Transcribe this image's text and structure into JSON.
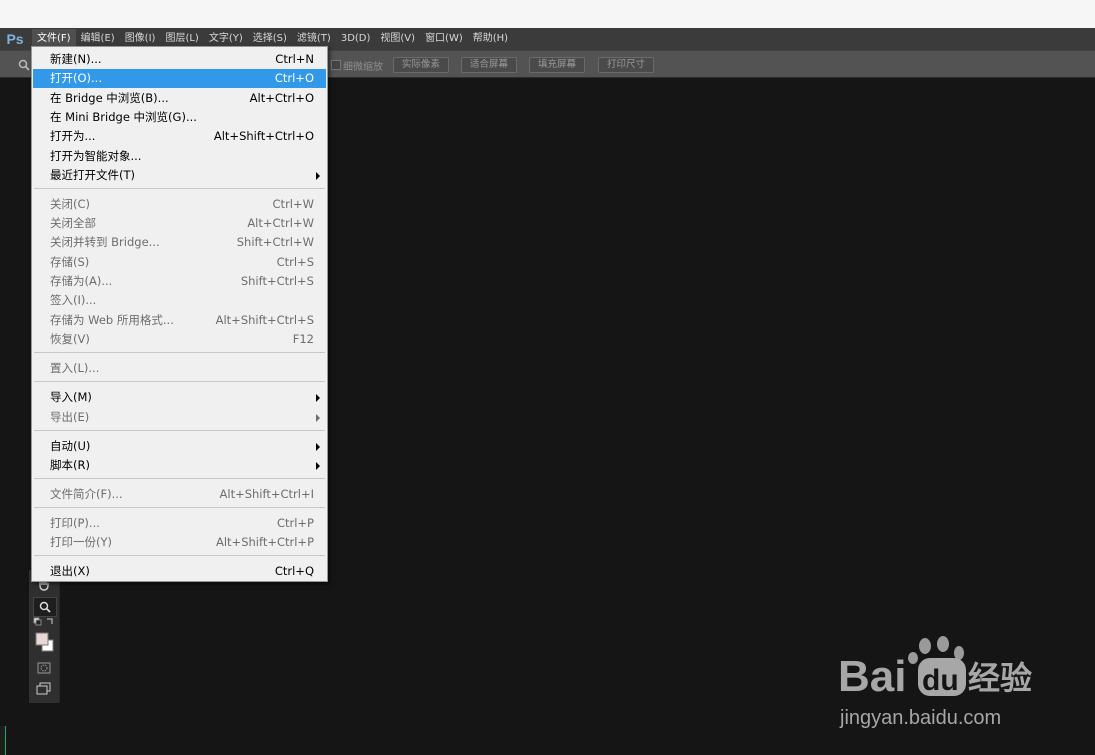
{
  "app": {
    "logo": "Ps"
  },
  "menubar": {
    "items": [
      "文件(F)",
      "编辑(E)",
      "图像(I)",
      "图层(L)",
      "文字(Y)",
      "选择(S)",
      "滤镜(T)",
      "3D(D)",
      "视图(V)",
      "窗口(W)",
      "帮助(H)"
    ]
  },
  "options_bar": {
    "checkbox_label": "细微缩放",
    "buttons": [
      "实际像素",
      "适合屏幕",
      "填充屏幕",
      "打印尺寸"
    ]
  },
  "file_menu": {
    "items": [
      {
        "label": "新建(N)...",
        "shortcut": "Ctrl+N"
      },
      {
        "label": "打开(O)...",
        "shortcut": "Ctrl+O"
      },
      {
        "label": "在 Bridge 中浏览(B)...",
        "shortcut": "Alt+Ctrl+O"
      },
      {
        "label": "在 Mini Bridge 中浏览(G)...",
        "shortcut": ""
      },
      {
        "label": "打开为...",
        "shortcut": "Alt+Shift+Ctrl+O"
      },
      {
        "label": "打开为智能对象...",
        "shortcut": ""
      },
      {
        "label": "最近打开文件(T)",
        "shortcut": ""
      },
      {
        "label": "关闭(C)",
        "shortcut": "Ctrl+W"
      },
      {
        "label": "关闭全部",
        "shortcut": "Alt+Ctrl+W"
      },
      {
        "label": "关闭并转到 Bridge...",
        "shortcut": "Shift+Ctrl+W"
      },
      {
        "label": "存储(S)",
        "shortcut": "Ctrl+S"
      },
      {
        "label": "存储为(A)...",
        "shortcut": "Shift+Ctrl+S"
      },
      {
        "label": "签入(I)...",
        "shortcut": ""
      },
      {
        "label": "存储为 Web 所用格式...",
        "shortcut": "Alt+Shift+Ctrl+S"
      },
      {
        "label": "恢复(V)",
        "shortcut": "F12"
      },
      {
        "label": "置入(L)...",
        "shortcut": ""
      },
      {
        "label": "导入(M)",
        "shortcut": ""
      },
      {
        "label": "导出(E)",
        "shortcut": ""
      },
      {
        "label": "自动(U)",
        "shortcut": ""
      },
      {
        "label": "脚本(R)",
        "shortcut": ""
      },
      {
        "label": "文件简介(F)...",
        "shortcut": "Alt+Shift+Ctrl+I"
      },
      {
        "label": "打印(P)...",
        "shortcut": "Ctrl+P"
      },
      {
        "label": "打印一份(Y)",
        "shortcut": "Alt+Shift+Ctrl+P"
      },
      {
        "label": "退出(X)",
        "shortcut": "Ctrl+Q"
      }
    ]
  },
  "watermark": {
    "brand_text": "Bai",
    "du_text": "du",
    "suffix_text": "经验",
    "url": "jingyan.baidu.com"
  },
  "colors": {
    "highlight": "#3199e8",
    "menu_bg": "#f0f0f0",
    "canvas_bg": "#151515"
  }
}
